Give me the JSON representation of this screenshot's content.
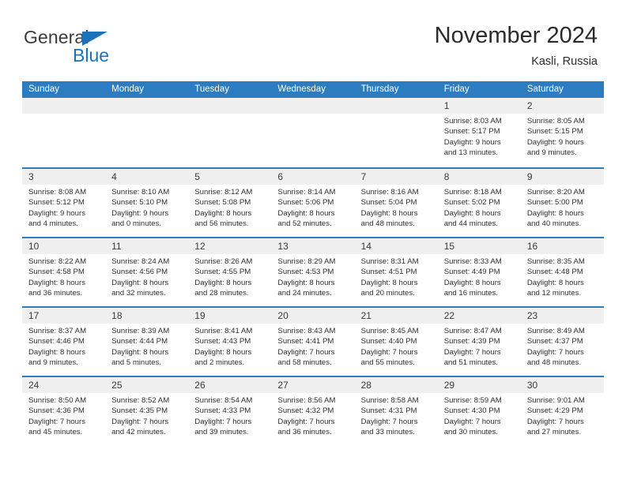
{
  "logo": {
    "primary_text": "General",
    "secondary_text": "Blue",
    "triangle_color": "#1a72bb",
    "primary_color": "#3b3b3b",
    "secondary_color": "#1a72bb"
  },
  "header": {
    "title": "November 2024",
    "subtitle": "Kasli, Russia"
  },
  "theme": {
    "header_bar_color": "#2b7cc0",
    "day_band_color": "#efefef",
    "row_divider_color": "#2b7cc0",
    "text_color": "#2f2f2f"
  },
  "weekdays": [
    "Sunday",
    "Monday",
    "Tuesday",
    "Wednesday",
    "Thursday",
    "Friday",
    "Saturday"
  ],
  "weeks": [
    [
      {
        "day": "",
        "empty": true,
        "sunrise": "",
        "sunset": "",
        "daylight_line1": "",
        "daylight_line2": ""
      },
      {
        "day": "",
        "empty": true,
        "sunrise": "",
        "sunset": "",
        "daylight_line1": "",
        "daylight_line2": ""
      },
      {
        "day": "",
        "empty": true,
        "sunrise": "",
        "sunset": "",
        "daylight_line1": "",
        "daylight_line2": ""
      },
      {
        "day": "",
        "empty": true,
        "sunrise": "",
        "sunset": "",
        "daylight_line1": "",
        "daylight_line2": ""
      },
      {
        "day": "",
        "empty": true,
        "sunrise": "",
        "sunset": "",
        "daylight_line1": "",
        "daylight_line2": ""
      },
      {
        "day": "1",
        "empty": false,
        "sunrise": "Sunrise: 8:03 AM",
        "sunset": "Sunset: 5:17 PM",
        "daylight_line1": "Daylight: 9 hours",
        "daylight_line2": "and 13 minutes."
      },
      {
        "day": "2",
        "empty": false,
        "sunrise": "Sunrise: 8:05 AM",
        "sunset": "Sunset: 5:15 PM",
        "daylight_line1": "Daylight: 9 hours",
        "daylight_line2": "and 9 minutes."
      }
    ],
    [
      {
        "day": "3",
        "empty": false,
        "sunrise": "Sunrise: 8:08 AM",
        "sunset": "Sunset: 5:12 PM",
        "daylight_line1": "Daylight: 9 hours",
        "daylight_line2": "and 4 minutes."
      },
      {
        "day": "4",
        "empty": false,
        "sunrise": "Sunrise: 8:10 AM",
        "sunset": "Sunset: 5:10 PM",
        "daylight_line1": "Daylight: 9 hours",
        "daylight_line2": "and 0 minutes."
      },
      {
        "day": "5",
        "empty": false,
        "sunrise": "Sunrise: 8:12 AM",
        "sunset": "Sunset: 5:08 PM",
        "daylight_line1": "Daylight: 8 hours",
        "daylight_line2": "and 56 minutes."
      },
      {
        "day": "6",
        "empty": false,
        "sunrise": "Sunrise: 8:14 AM",
        "sunset": "Sunset: 5:06 PM",
        "daylight_line1": "Daylight: 8 hours",
        "daylight_line2": "and 52 minutes."
      },
      {
        "day": "7",
        "empty": false,
        "sunrise": "Sunrise: 8:16 AM",
        "sunset": "Sunset: 5:04 PM",
        "daylight_line1": "Daylight: 8 hours",
        "daylight_line2": "and 48 minutes."
      },
      {
        "day": "8",
        "empty": false,
        "sunrise": "Sunrise: 8:18 AM",
        "sunset": "Sunset: 5:02 PM",
        "daylight_line1": "Daylight: 8 hours",
        "daylight_line2": "and 44 minutes."
      },
      {
        "day": "9",
        "empty": false,
        "sunrise": "Sunrise: 8:20 AM",
        "sunset": "Sunset: 5:00 PM",
        "daylight_line1": "Daylight: 8 hours",
        "daylight_line2": "and 40 minutes."
      }
    ],
    [
      {
        "day": "10",
        "empty": false,
        "sunrise": "Sunrise: 8:22 AM",
        "sunset": "Sunset: 4:58 PM",
        "daylight_line1": "Daylight: 8 hours",
        "daylight_line2": "and 36 minutes."
      },
      {
        "day": "11",
        "empty": false,
        "sunrise": "Sunrise: 8:24 AM",
        "sunset": "Sunset: 4:56 PM",
        "daylight_line1": "Daylight: 8 hours",
        "daylight_line2": "and 32 minutes."
      },
      {
        "day": "12",
        "empty": false,
        "sunrise": "Sunrise: 8:26 AM",
        "sunset": "Sunset: 4:55 PM",
        "daylight_line1": "Daylight: 8 hours",
        "daylight_line2": "and 28 minutes."
      },
      {
        "day": "13",
        "empty": false,
        "sunrise": "Sunrise: 8:29 AM",
        "sunset": "Sunset: 4:53 PM",
        "daylight_line1": "Daylight: 8 hours",
        "daylight_line2": "and 24 minutes."
      },
      {
        "day": "14",
        "empty": false,
        "sunrise": "Sunrise: 8:31 AM",
        "sunset": "Sunset: 4:51 PM",
        "daylight_line1": "Daylight: 8 hours",
        "daylight_line2": "and 20 minutes."
      },
      {
        "day": "15",
        "empty": false,
        "sunrise": "Sunrise: 8:33 AM",
        "sunset": "Sunset: 4:49 PM",
        "daylight_line1": "Daylight: 8 hours",
        "daylight_line2": "and 16 minutes."
      },
      {
        "day": "16",
        "empty": false,
        "sunrise": "Sunrise: 8:35 AM",
        "sunset": "Sunset: 4:48 PM",
        "daylight_line1": "Daylight: 8 hours",
        "daylight_line2": "and 12 minutes."
      }
    ],
    [
      {
        "day": "17",
        "empty": false,
        "sunrise": "Sunrise: 8:37 AM",
        "sunset": "Sunset: 4:46 PM",
        "daylight_line1": "Daylight: 8 hours",
        "daylight_line2": "and 9 minutes."
      },
      {
        "day": "18",
        "empty": false,
        "sunrise": "Sunrise: 8:39 AM",
        "sunset": "Sunset: 4:44 PM",
        "daylight_line1": "Daylight: 8 hours",
        "daylight_line2": "and 5 minutes."
      },
      {
        "day": "19",
        "empty": false,
        "sunrise": "Sunrise: 8:41 AM",
        "sunset": "Sunset: 4:43 PM",
        "daylight_line1": "Daylight: 8 hours",
        "daylight_line2": "and 2 minutes."
      },
      {
        "day": "20",
        "empty": false,
        "sunrise": "Sunrise: 8:43 AM",
        "sunset": "Sunset: 4:41 PM",
        "daylight_line1": "Daylight: 7 hours",
        "daylight_line2": "and 58 minutes."
      },
      {
        "day": "21",
        "empty": false,
        "sunrise": "Sunrise: 8:45 AM",
        "sunset": "Sunset: 4:40 PM",
        "daylight_line1": "Daylight: 7 hours",
        "daylight_line2": "and 55 minutes."
      },
      {
        "day": "22",
        "empty": false,
        "sunrise": "Sunrise: 8:47 AM",
        "sunset": "Sunset: 4:39 PM",
        "daylight_line1": "Daylight: 7 hours",
        "daylight_line2": "and 51 minutes."
      },
      {
        "day": "23",
        "empty": false,
        "sunrise": "Sunrise: 8:49 AM",
        "sunset": "Sunset: 4:37 PM",
        "daylight_line1": "Daylight: 7 hours",
        "daylight_line2": "and 48 minutes."
      }
    ],
    [
      {
        "day": "24",
        "empty": false,
        "sunrise": "Sunrise: 8:50 AM",
        "sunset": "Sunset: 4:36 PM",
        "daylight_line1": "Daylight: 7 hours",
        "daylight_line2": "and 45 minutes."
      },
      {
        "day": "25",
        "empty": false,
        "sunrise": "Sunrise: 8:52 AM",
        "sunset": "Sunset: 4:35 PM",
        "daylight_line1": "Daylight: 7 hours",
        "daylight_line2": "and 42 minutes."
      },
      {
        "day": "26",
        "empty": false,
        "sunrise": "Sunrise: 8:54 AM",
        "sunset": "Sunset: 4:33 PM",
        "daylight_line1": "Daylight: 7 hours",
        "daylight_line2": "and 39 minutes."
      },
      {
        "day": "27",
        "empty": false,
        "sunrise": "Sunrise: 8:56 AM",
        "sunset": "Sunset: 4:32 PM",
        "daylight_line1": "Daylight: 7 hours",
        "daylight_line2": "and 36 minutes."
      },
      {
        "day": "28",
        "empty": false,
        "sunrise": "Sunrise: 8:58 AM",
        "sunset": "Sunset: 4:31 PM",
        "daylight_line1": "Daylight: 7 hours",
        "daylight_line2": "and 33 minutes."
      },
      {
        "day": "29",
        "empty": false,
        "sunrise": "Sunrise: 8:59 AM",
        "sunset": "Sunset: 4:30 PM",
        "daylight_line1": "Daylight: 7 hours",
        "daylight_line2": "and 30 minutes."
      },
      {
        "day": "30",
        "empty": false,
        "sunrise": "Sunrise: 9:01 AM",
        "sunset": "Sunset: 4:29 PM",
        "daylight_line1": "Daylight: 7 hours",
        "daylight_line2": "and 27 minutes."
      }
    ]
  ]
}
